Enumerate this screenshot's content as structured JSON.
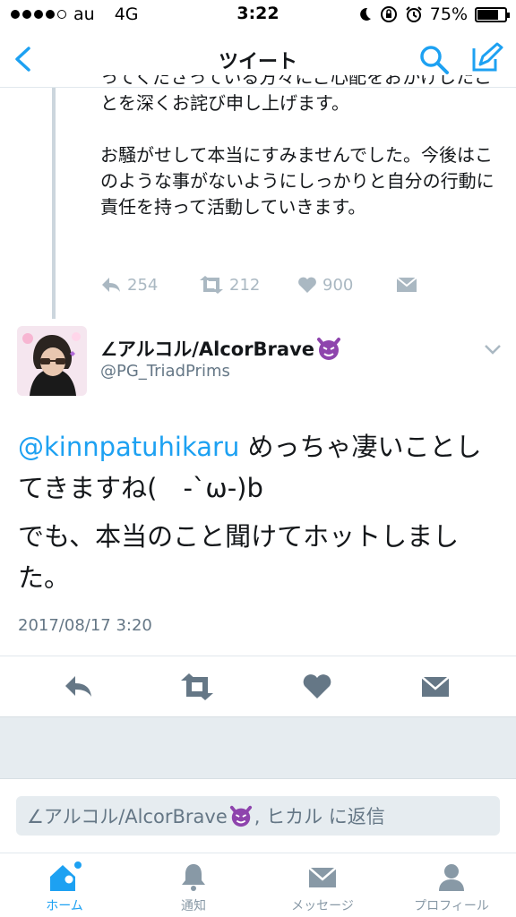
{
  "status": {
    "carrier": "au",
    "network": "4G",
    "time": "3:22",
    "battery": "75%",
    "battery_level": 0.75
  },
  "nav": {
    "title": "ツイート"
  },
  "prev_tweet": {
    "paragraphs": [
      "ってくださっている方々にご心配をおかけしたことを深くお詫び申し上げます。",
      "お騒がせして本当にすみませんでした。今後はこのような事がないようにしっかりと自分の行動に責任を持って活動していきます。"
    ],
    "replies": "254",
    "retweets": "212",
    "likes": "900"
  },
  "tweet": {
    "display_name": "∠アルコル/AlcorBrave",
    "handle": "@PG_TriadPrims",
    "mention": "@kinnpatuhikaru",
    "line1_rest": " めっちゃ凄いことしてきますね(　-`ω-)b",
    "line2": "でも、本当のこと聞けてホットしました。",
    "date": "2017/08/17 3:20"
  },
  "reply": {
    "prefix": "∠アルコル/AlcorBrave",
    "suffix": ", ヒカル に返信"
  },
  "tabs": [
    {
      "label": "ホーム",
      "icon": "home-icon"
    },
    {
      "label": "通知",
      "icon": "bell-icon"
    },
    {
      "label": "メッセージ",
      "icon": "envelope-icon"
    },
    {
      "label": "プロフィール",
      "icon": "person-icon"
    }
  ],
  "colors": {
    "accent": "#1da1f2",
    "muted": "#aab8c2",
    "devil": "#8e44ad"
  }
}
